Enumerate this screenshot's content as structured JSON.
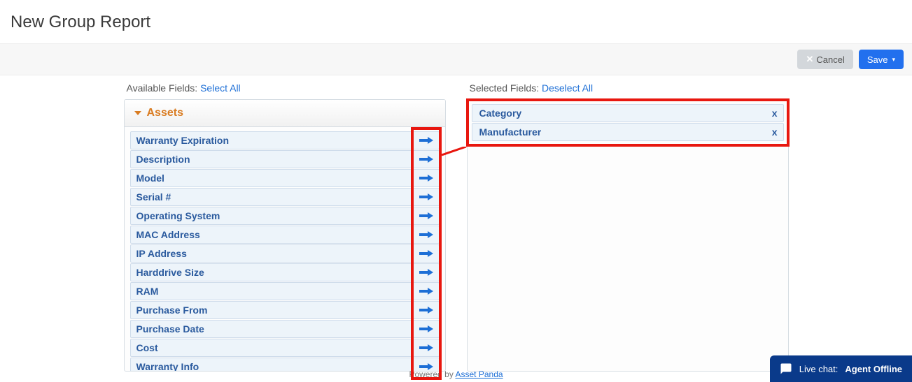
{
  "page": {
    "title": "New Group Report"
  },
  "toolbar": {
    "cancel_label": "Cancel",
    "save_label": "Save"
  },
  "available": {
    "header_prefix": "Available Fields: ",
    "header_link": "Select All",
    "accordion_title": "Assets",
    "fields": [
      "Warranty Expiration",
      "Description",
      "Model",
      "Serial #",
      "Operating System",
      "MAC Address",
      "IP Address",
      "Harddrive Size",
      "RAM",
      "Purchase From",
      "Purchase Date",
      "Cost",
      "Warranty Info"
    ]
  },
  "selected": {
    "header_prefix": "Selected Fields: ",
    "header_link": "Deselect All",
    "fields": [
      "Category",
      "Manufacturer"
    ]
  },
  "footer": {
    "prefix": "Powered by ",
    "link": "Asset Panda"
  },
  "chat": {
    "prefix": "Live chat:",
    "status": "Agent Offline"
  }
}
